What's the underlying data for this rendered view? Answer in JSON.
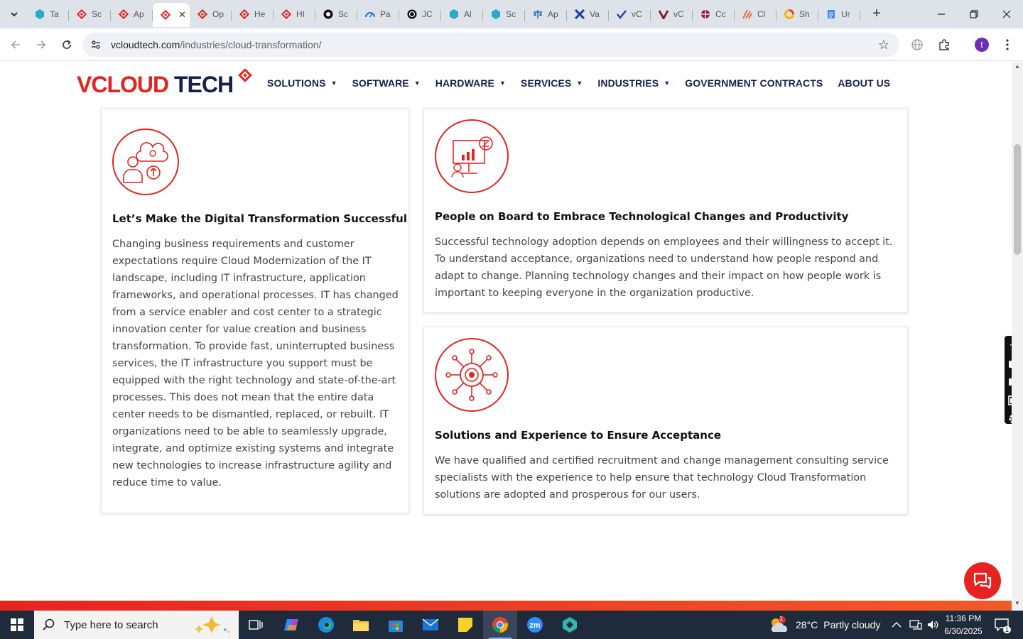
{
  "browser": {
    "tabs": [
      {
        "label": "Ta",
        "icon": "teal-hexagon-icon"
      },
      {
        "label": "Sc",
        "icon": "vcloud-icon"
      },
      {
        "label": "Ap",
        "icon": "vcloud-icon"
      },
      {
        "label": "",
        "icon": "vcloud-icon",
        "active": true
      },
      {
        "label": "Op",
        "icon": "vcloud-icon"
      },
      {
        "label": "He",
        "icon": "vcloud-icon"
      },
      {
        "label": "HI",
        "icon": "vcloud-icon"
      },
      {
        "label": "Sc",
        "icon": "github-icon"
      },
      {
        "label": "Pa",
        "icon": "gauge-icon"
      },
      {
        "label": "JC",
        "icon": "openai-icon"
      },
      {
        "label": "Al",
        "icon": "teal-hexagon-icon"
      },
      {
        "label": "Sc",
        "icon": "teal-hexagon-icon"
      },
      {
        "label": "Ap",
        "icon": "scales-icon"
      },
      {
        "label": "Va",
        "icon": "x-logo-icon"
      },
      {
        "label": "vC",
        "icon": "check-logo-icon"
      },
      {
        "label": "vC",
        "icon": "v-logo-icon"
      },
      {
        "label": "Cc",
        "icon": "pinwheel-icon"
      },
      {
        "label": "Cl",
        "icon": "claude-icon"
      },
      {
        "label": "Sh",
        "icon": "ring-icon"
      },
      {
        "label": "Ur",
        "icon": "docs-icon"
      }
    ],
    "close_tab_glyph": "✕",
    "new_tab_glyph": "+",
    "url_host": "vcloudtech.com",
    "url_path": "/industries/cloud-transformation/",
    "profile_initial": "t"
  },
  "site": {
    "logo_part1": "VCLOUD",
    "logo_part2": " TECH",
    "nav": [
      {
        "label": "SOLUTIONS",
        "dropdown": true
      },
      {
        "label": "SOFTWARE",
        "dropdown": true
      },
      {
        "label": "HARDWARE",
        "dropdown": true
      },
      {
        "label": "SERVICES",
        "dropdown": true
      },
      {
        "label": "INDUSTRIES",
        "dropdown": true
      },
      {
        "label": "GOVERNMENT CONTRACTS",
        "dropdown": false
      },
      {
        "label": "ABOUT US",
        "dropdown": false
      }
    ],
    "accent_color": "#e52421",
    "navy_color": "#15214a"
  },
  "cards": [
    {
      "title": "Let’s Make the Digital Transformation Successful",
      "body": "Changing business requirements and customer expectations require Cloud Modernization of the IT landscape, including IT infrastructure, application frameworks, and operational processes. IT has changed from a service enabler and cost center to a strategic innovation center for value creation and business transformation. To provide fast, uninterrupted business services, the IT infrastructure you support must be equipped with the right technology and state-of-the-art processes. This does not mean that the entire data center needs to be dismantled, replaced, or rebuilt. IT organizations need to be able to seamlessly upgrade, integrate, and optimize existing systems and integrate new technologies to increase infrastructure agility and reduce time to value.",
      "icon": "cloud-gear-person-icon"
    },
    {
      "title": "People on Board to Embrace Technological Changes and Productivity",
      "body": "Successful technology adoption depends on employees and their willingness to accept it. To understand acceptance, organizations need to understand how people respond and adapt to change. Planning technology changes and their impact on how people work is important to keeping everyone in the organization productive.",
      "icon": "presentation-chart-icon"
    },
    {
      "title": "Solutions and Experience to Ensure Acceptance",
      "body": "We have qualified and certified recruitment and change management consulting service specialists with the experience to help ensure that technology Cloud Transformation solutions are adopted and prosperous for our users.",
      "icon": "network-gear-icon"
    }
  ],
  "taskbar": {
    "search_placeholder": "Type here to search",
    "weather_temp": "28°C",
    "weather_desc": "Partly cloudy",
    "weather_badge": "1",
    "time": "11:36 PM",
    "date": "6/30/2025",
    "notification_count": "1"
  }
}
